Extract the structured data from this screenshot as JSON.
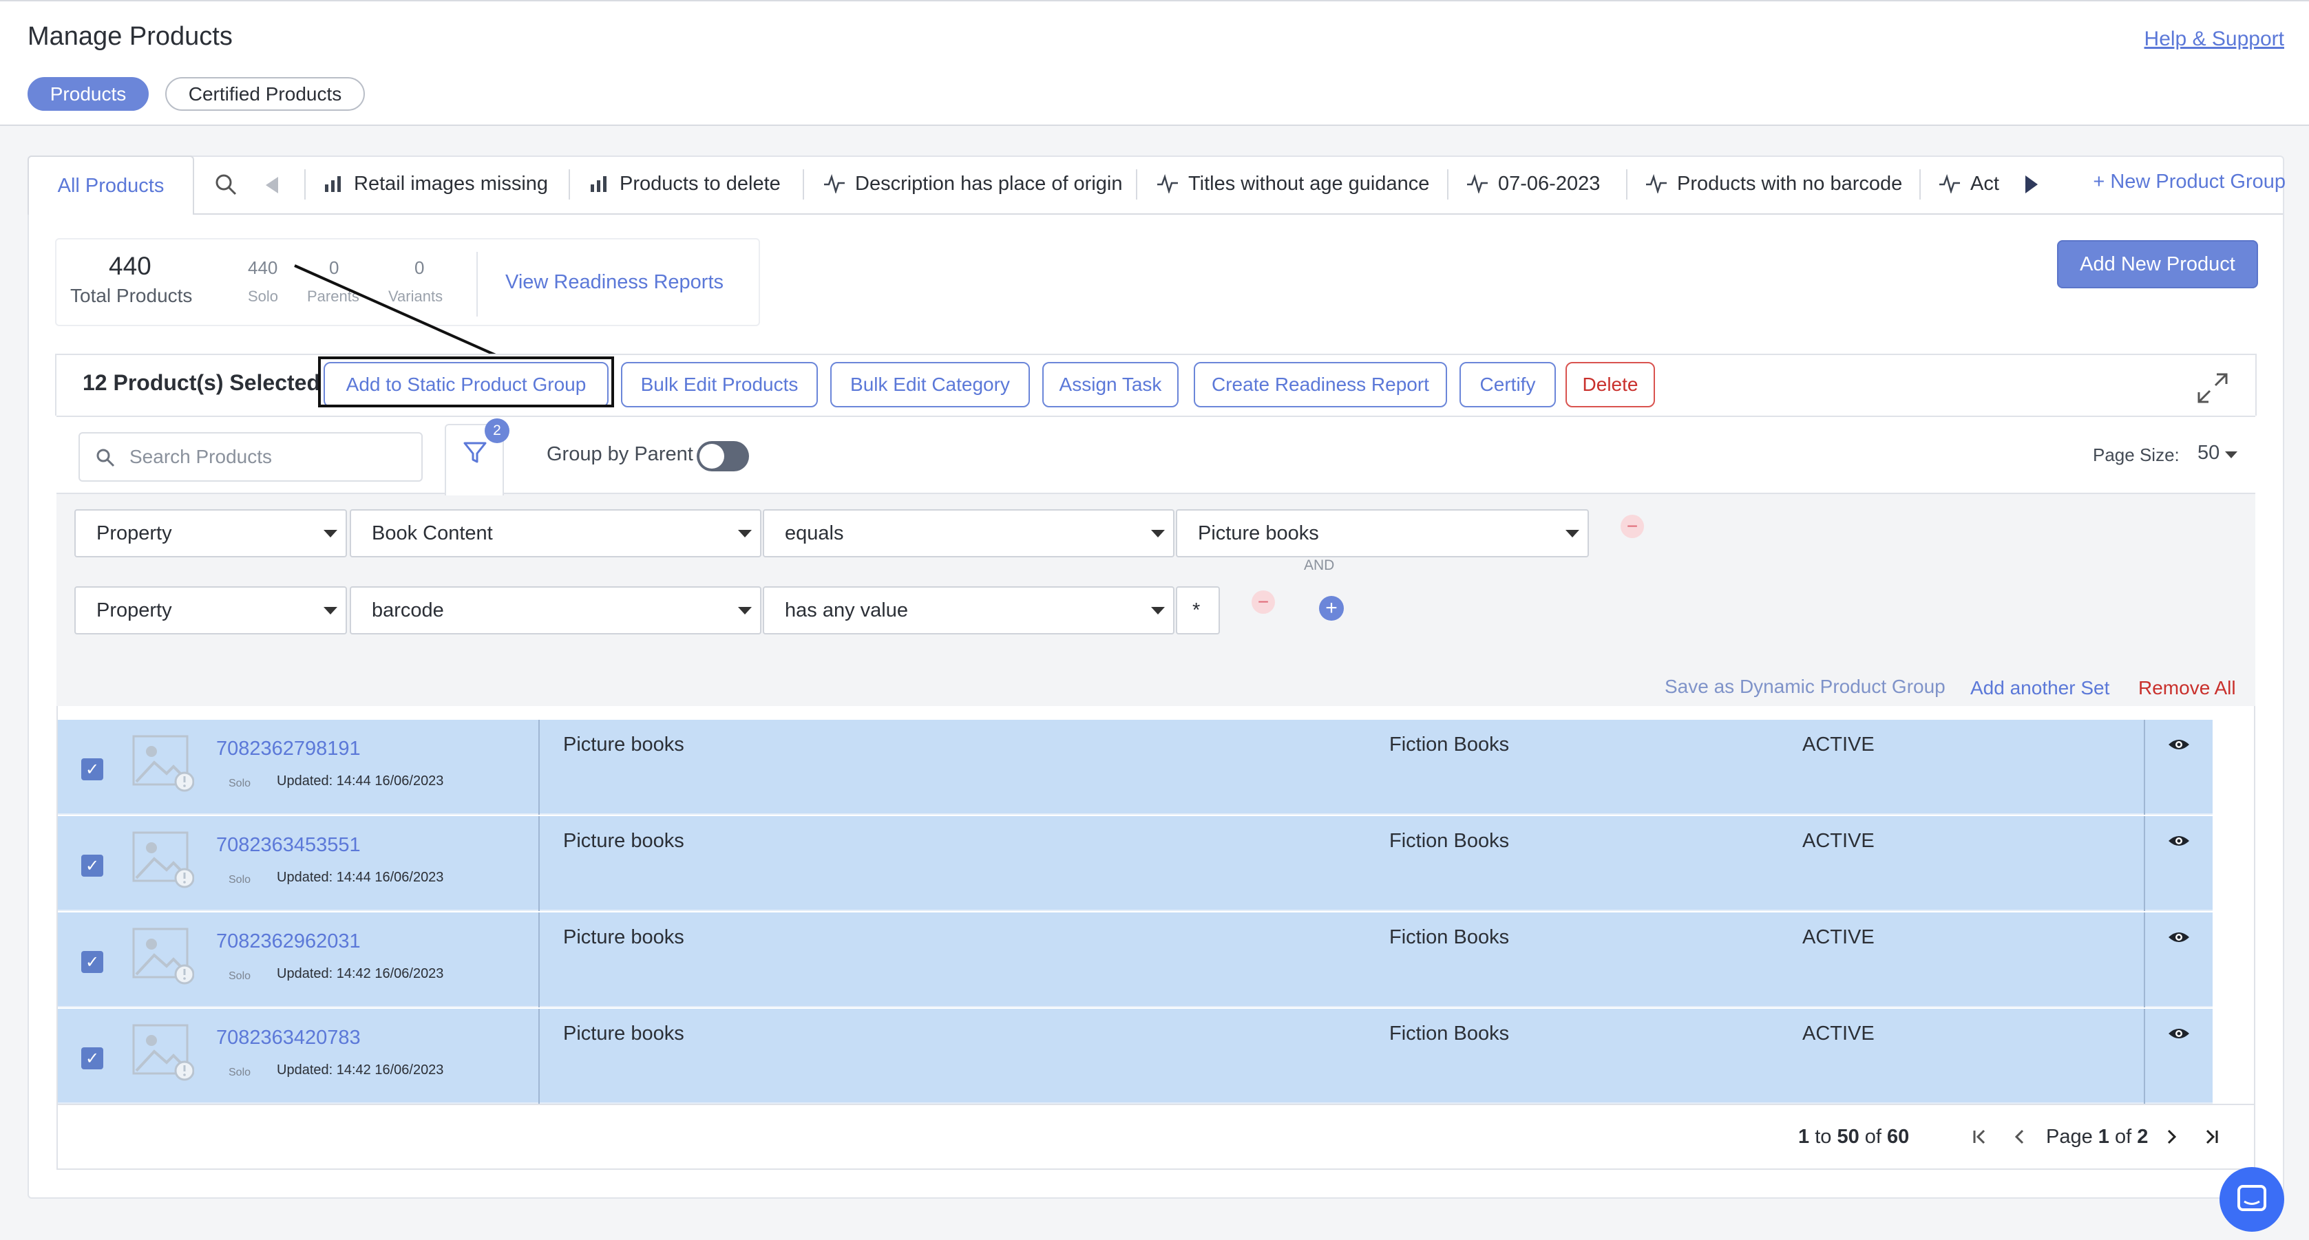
{
  "header": {
    "title": "Manage Products",
    "help_link": "Help & Support",
    "tabs": [
      {
        "label": "Products",
        "active": true
      },
      {
        "label": "Certified Products",
        "active": false
      }
    ]
  },
  "product_groups": {
    "all_tab": "All Products",
    "items": [
      {
        "label": "Retail images missing",
        "icon": "bar-chart-icon"
      },
      {
        "label": "Products to delete",
        "icon": "bar-chart-icon"
      },
      {
        "label": "Description has place of origin",
        "icon": "pulse-icon"
      },
      {
        "label": "Titles without age guidance",
        "icon": "pulse-icon"
      },
      {
        "label": "07-06-2023",
        "icon": "pulse-icon"
      },
      {
        "label": "Products with no barcode",
        "icon": "pulse-icon"
      },
      {
        "label": "Act",
        "icon": "pulse-icon"
      }
    ],
    "new_group": "+ New Product Group"
  },
  "stats": {
    "total": "440",
    "total_label": "Total Products",
    "solo": "440",
    "solo_label": "Solo",
    "parents": "0",
    "parents_label": "Parents",
    "variants": "0",
    "variants_label": "Variants",
    "readiness_link": "View Readiness Reports"
  },
  "add_new_button": "Add New Product",
  "selection": {
    "count_label": "12 Product(s) Selected",
    "actions": [
      "Add to Static Product Group",
      "Bulk Edit Products",
      "Bulk Edit Category",
      "Assign Task",
      "Create Readiness Report",
      "Certify",
      "Delete"
    ]
  },
  "toolbar": {
    "search_placeholder": "Search Products",
    "filter_count": "2",
    "group_by_parent": "Group by Parent",
    "page_size_label": "Page Size:",
    "page_size": "50"
  },
  "filters": {
    "rows": [
      {
        "field": "Property",
        "property": "Book Content",
        "operator": "equals",
        "value": "Picture books"
      },
      {
        "field": "Property",
        "property": "barcode",
        "operator": "has any value",
        "value": "*"
      }
    ],
    "connector": "AND",
    "save_dynamic": "Save as Dynamic Product Group",
    "add_set": "Add another Set",
    "remove_all": "Remove All"
  },
  "products": [
    {
      "id": "7082362798191",
      "type": "Solo",
      "updated": "Updated: 14:44 16/06/2023",
      "content": "Picture books",
      "category": "Fiction Books",
      "status": "ACTIVE"
    },
    {
      "id": "7082363453551",
      "type": "Solo",
      "updated": "Updated: 14:44 16/06/2023",
      "content": "Picture books",
      "category": "Fiction Books",
      "status": "ACTIVE"
    },
    {
      "id": "7082362962031",
      "type": "Solo",
      "updated": "Updated: 14:42 16/06/2023",
      "content": "Picture books",
      "category": "Fiction Books",
      "status": "ACTIVE"
    },
    {
      "id": "7082363420783",
      "type": "Solo",
      "updated": "Updated: 14:42 16/06/2023",
      "content": "Picture books",
      "category": "Fiction Books",
      "status": "ACTIVE"
    }
  ],
  "pagination": {
    "from": "1",
    "to_word": "to",
    "to": "50",
    "of_word": "of",
    "total": "60",
    "page_word": "Page",
    "page": "1",
    "pages": "2"
  },
  "colors": {
    "accent": "#6b86d9",
    "row_selected": "#c6ddf6",
    "danger": "#c9302c"
  }
}
